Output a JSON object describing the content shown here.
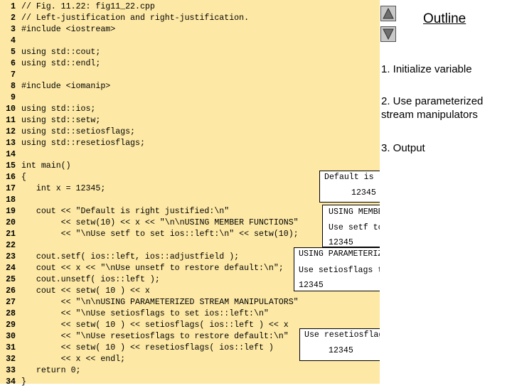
{
  "code_lines": [
    {
      "n": "1",
      "t": "// Fig. 11.22: fig11_22.cpp"
    },
    {
      "n": "2",
      "t": "// Left-justification and right-justification."
    },
    {
      "n": "3",
      "t": "#include <iostream>"
    },
    {
      "n": "4",
      "t": ""
    },
    {
      "n": "5",
      "t": "using std::cout;"
    },
    {
      "n": "6",
      "t": "using std::endl;"
    },
    {
      "n": "7",
      "t": ""
    },
    {
      "n": "8",
      "t": "#include <iomanip>"
    },
    {
      "n": "9",
      "t": ""
    },
    {
      "n": "10",
      "t": "using std::ios;"
    },
    {
      "n": "11",
      "t": "using std::setw;"
    },
    {
      "n": "12",
      "t": "using std::setiosflags;"
    },
    {
      "n": "13",
      "t": "using std::resetiosflags;"
    },
    {
      "n": "14",
      "t": ""
    },
    {
      "n": "15",
      "t": "int main()"
    },
    {
      "n": "16",
      "t": "{"
    },
    {
      "n": "17",
      "t": "   int x = 12345;"
    },
    {
      "n": "18",
      "t": ""
    },
    {
      "n": "19",
      "t": "   cout << \"Default is right justified:\\n\""
    },
    {
      "n": "20",
      "t": "        << setw(10) << x << \"\\n\\nUSING MEMBER FUNCTIONS\""
    },
    {
      "n": "21",
      "t": "        << \"\\nUse setf to set ios::left:\\n\" << setw(10);"
    },
    {
      "n": "22",
      "t": ""
    },
    {
      "n": "23",
      "t": "   cout.setf( ios::left, ios::adjustfield );"
    },
    {
      "n": "24",
      "t": "   cout << x << \"\\nUse unsetf to restore default:\\n\";"
    },
    {
      "n": "25",
      "t": "   cout.unsetf( ios::left );"
    },
    {
      "n": "26",
      "t": "   cout << setw( 10 ) << x"
    },
    {
      "n": "27",
      "t": "        << \"\\n\\nUSING PARAMETERIZED STREAM MANIPULATORS\""
    },
    {
      "n": "28",
      "t": "        << \"\\nUse setiosflags to set ios::left:\\n\""
    },
    {
      "n": "29",
      "t": "        << setw( 10 ) << setiosflags( ios::left ) << x"
    },
    {
      "n": "30",
      "t": "        << \"\\nUse resetiosflags to restore default:\\n\""
    },
    {
      "n": "31",
      "t": "        << setw( 10 ) << resetiosflags( ios::left )"
    },
    {
      "n": "32",
      "t": "        << x << endl;"
    },
    {
      "n": "33",
      "t": "   return 0;"
    },
    {
      "n": "34",
      "t": "}"
    }
  ],
  "outline": {
    "title": "Outline",
    "items": [
      "1. Initialize variable",
      "2. Use parameterized stream manipulators",
      "3. Output"
    ]
  },
  "output_boxes": [
    {
      "lines": [
        "Default is right justified:",
        "12345"
      ]
    },
    {
      "lines": [
        "USING MEMBER FUNCTIONS",
        "Use setf to set ios::left:",
        "12345"
      ]
    },
    {
      "lines": [
        "USING PARAMETERIZED STREAM MANIPULATORS",
        "Use setiosflags to set ios::left:",
        "12345"
      ]
    },
    {
      "lines": [
        "Use resetiosflags to restore default:",
        "12345"
      ]
    }
  ],
  "nav": {
    "up_icon": "triangle-up-icon",
    "down_icon": "triangle-down-icon"
  },
  "colors": {
    "code_background": "#fde9a5",
    "nav_button": "#c8c8c8"
  }
}
